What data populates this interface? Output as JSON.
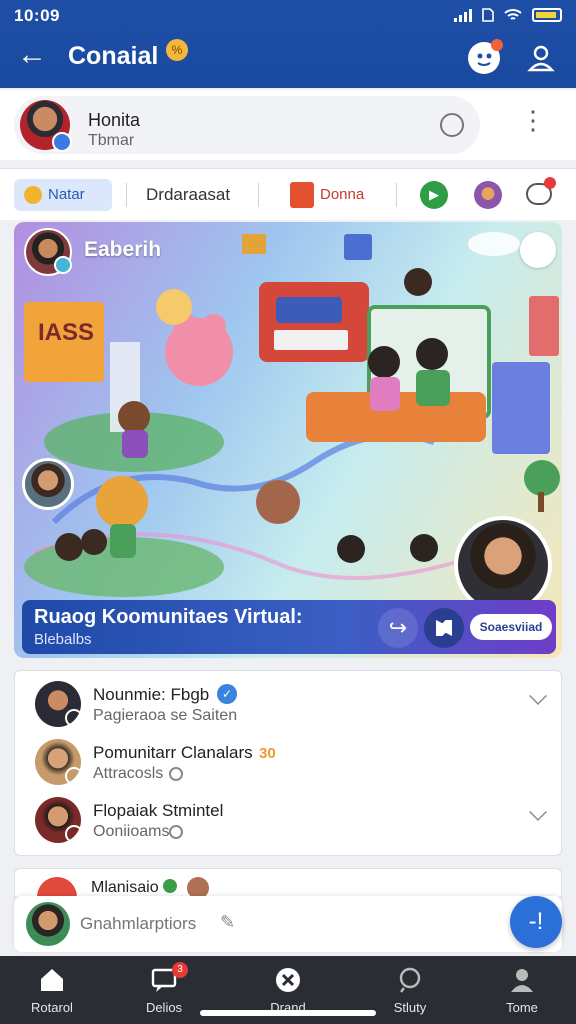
{
  "status_bar": {
    "time": "10:09"
  },
  "header": {
    "title": "Conaial",
    "title_badge": "%",
    "back_icon": "arrow-left-icon",
    "notification_icon": "avatar-notification-icon",
    "profile_icon": "user-icon"
  },
  "profile": {
    "name": "Honita",
    "status": "Tbmar",
    "badge_icon": "verified-icon",
    "sync_icon": "cloud-sync-icon",
    "more_icon": "more-vertical-icon"
  },
  "tabs": [
    {
      "label": "Natar",
      "icon": "coin-icon",
      "active": true
    },
    {
      "label": "Drdaraasat",
      "icon": "",
      "active": false
    },
    {
      "label": "Donna",
      "icon": "gift-box-icon",
      "active": false
    }
  ],
  "tab_icons": [
    "play-circle-icon",
    "avatar-icon",
    "chat-bubble-icon"
  ],
  "hero": {
    "title": "Eaberih",
    "banner_title": "Ruaog Koomunitaes Virtual:",
    "banner_subtitle": "Blebalbs",
    "pill_label": "Soaesviiad",
    "share_icon": "share-icon",
    "expand_icon": "expand-icon",
    "emoji_icon": "emoji-icon"
  },
  "members": [
    {
      "name": "Nounmie: Fbgb",
      "sub": "Pagieraoa se Saiten",
      "extra": "",
      "verified": true,
      "chevron": true,
      "avatar_color": "#3b3b46",
      "badge_color": "#3a84de"
    },
    {
      "name": "Pomunitarr Clanalars",
      "sub": "Attracosls",
      "extra": "30",
      "verified": false,
      "chevron": false,
      "avatar_color": "#c69b6b",
      "badge_color": "#7a63c9"
    },
    {
      "name": "Flopaiak Stmintel",
      "sub": "Ooniioams",
      "extra": "",
      "verified": false,
      "chevron": true,
      "avatar_color": "#7b2a2a",
      "badge_color": "#c23ea3"
    }
  ],
  "peek": {
    "name": "Mlanisaio"
  },
  "composer": {
    "placeholder": "Gnahmlarptiors",
    "send_icon": "plus-icon",
    "fab_label": "-!"
  },
  "bottom_nav": [
    {
      "label": "Rotarol",
      "icon": "home-icon",
      "badge": ""
    },
    {
      "label": "Delios",
      "icon": "message-icon",
      "badge": "3"
    },
    {
      "label": "Drand",
      "icon": "close-circle-icon",
      "badge": ""
    },
    {
      "label": "Stluty",
      "icon": "search-icon",
      "badge": ""
    },
    {
      "label": "Tome",
      "icon": "person-icon",
      "badge": ""
    }
  ],
  "colors": {
    "primary": "#1f4ea6",
    "accent": "#2b6fd8",
    "nav_bg": "#2a2d33",
    "banner": "#1f4aa8"
  }
}
